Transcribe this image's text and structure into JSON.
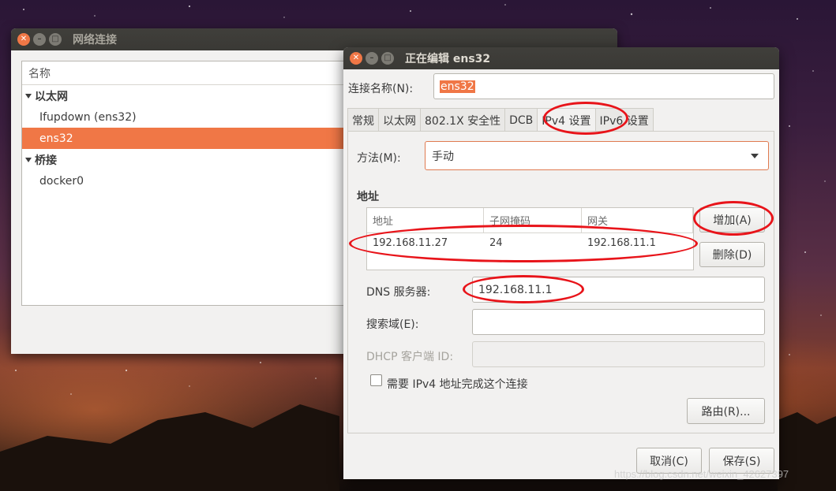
{
  "back_window": {
    "title": "网络连接",
    "list_header": "名称",
    "groups": [
      {
        "label": "以太网",
        "items": [
          "Ifupdown (ens32)",
          "ens32"
        ]
      },
      {
        "label": "桥接",
        "items": [
          "docker0"
        ]
      }
    ],
    "selected_item": "ens32"
  },
  "dialog": {
    "title": "正在编辑 ens32",
    "conn_name_label": "连接名称(N):",
    "conn_name_value": "ens32",
    "tabs": [
      "常规",
      "以太网",
      "802.1X 安全性",
      "DCB",
      "IPv4 设置",
      "IPv6 设置"
    ],
    "active_tab": "IPv4 设置",
    "method_label": "方法(M):",
    "method_value": "手动",
    "address_section": "地址",
    "address_columns": [
      "地址",
      "子网掩码",
      "网关"
    ],
    "address_rows": [
      [
        "192.168.11.27",
        "24",
        "192.168.11.1"
      ]
    ],
    "add_button": "增加(A)",
    "delete_button": "删除(D)",
    "dns_label": "DNS 服务器:",
    "dns_value": "192.168.11.1",
    "search_label": "搜索域(E):",
    "search_value": "",
    "dhcp_label": "DHCP 客户端 ID:",
    "dhcp_value": "",
    "require_ipv4_label": "需要 IPv4 地址完成这个连接",
    "require_ipv4_checked": false,
    "routes_button": "路由(R)...",
    "cancel_button": "取消(C)",
    "save_button": "保存(S)"
  },
  "watermark": "https://blog.csdn.net/weixin_42627397",
  "colors": {
    "accent": "#f07746",
    "annotation_red": "#e8141a",
    "titlebar": "#3c3b37"
  }
}
